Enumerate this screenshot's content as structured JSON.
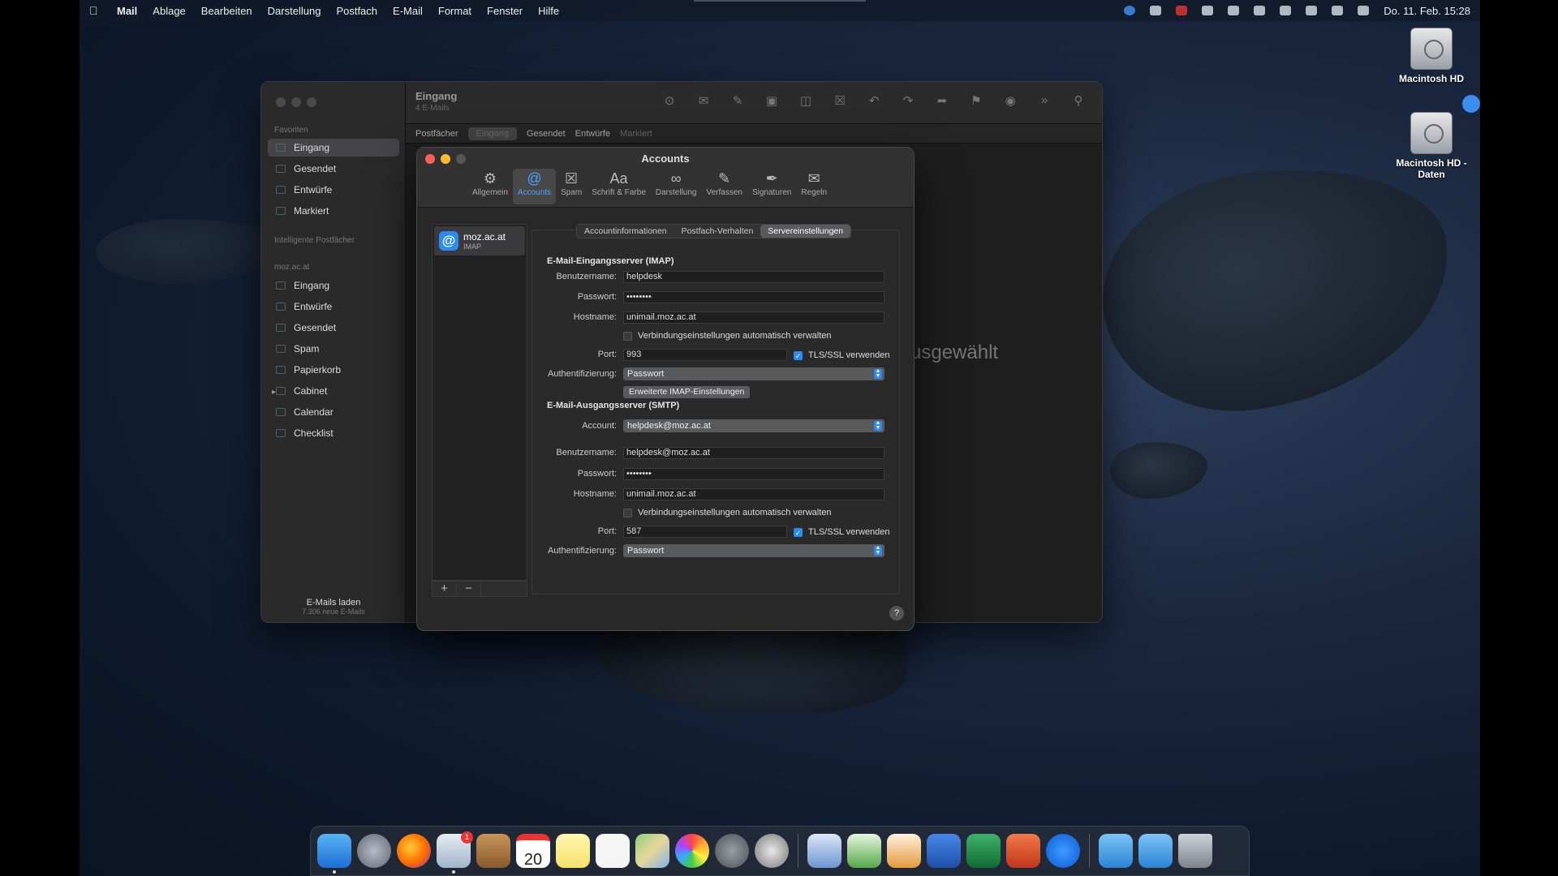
{
  "menubar": {
    "app": "Mail",
    "items": [
      "Ablage",
      "Bearbeiten",
      "Darstellung",
      "Postfach",
      "E-Mail",
      "Format",
      "Fenster",
      "Hilfe"
    ],
    "clock": "Do. 11. Feb. 15:28"
  },
  "desktop": {
    "disk1": "Macintosh HD",
    "disk2": "Macintosh HD - Daten"
  },
  "mail": {
    "toolbar_title": "Eingang",
    "toolbar_sub": "4 E-Mails",
    "favbar": {
      "postfaecher": "Postfächer",
      "eingang": "Eingang",
      "gesendet": "Gesendet",
      "entwuerfe": "Entwürfe",
      "markiert": "Markiert"
    },
    "sidebar": {
      "favoriten": "Favoriten",
      "fav_items": [
        "Eingang",
        "Gesendet",
        "Entwürfe",
        "Markiert"
      ],
      "intelligente": "Intelligente Postfächer",
      "account": "moz.ac.at",
      "acc_items": [
        "Eingang",
        "Entwürfe",
        "Gesendet",
        "Spam",
        "Papierkorb",
        "Cabinet",
        "Calendar",
        "Checklist"
      ],
      "footer_a": "E-Mails laden",
      "footer_b": "7.306 neue E-Mails"
    },
    "empty": "usgewählt"
  },
  "prefs": {
    "title": "Accounts",
    "tabs": [
      "Allgemein",
      "Accounts",
      "Spam",
      "Schrift & Farbe",
      "Darstellung",
      "Verfassen",
      "Signaturen",
      "Regeln"
    ],
    "account_name": "moz.ac.at",
    "account_type": "IMAP",
    "subtabs": [
      "Accountinformationen",
      "Postfach-Verhalten",
      "Servereinstellungen"
    ],
    "imap": {
      "heading": "E-Mail-Eingangsserver (IMAP)",
      "user_label": "Benutzername:",
      "user": "helpdesk",
      "pass_label": "Passwort:",
      "pass": "••••••••",
      "host_label": "Hostname:",
      "host": "unimail.moz.ac.at",
      "auto": "Verbindungseinstellungen automatisch verwalten",
      "port_label": "Port:",
      "port": "993",
      "tls": "TLS/SSL verwenden",
      "auth_label": "Authentifizierung:",
      "auth": "Passwort",
      "advanced": "Erweiterte IMAP-Einstellungen"
    },
    "smtp": {
      "heading": "E-Mail-Ausgangsserver (SMTP)",
      "account_label": "Account:",
      "account": "helpdesk@moz.ac.at",
      "user_label": "Benutzername:",
      "user": "helpdesk@moz.ac.at",
      "pass_label": "Passwort:",
      "pass": "••••••••",
      "host_label": "Hostname:",
      "host": "unimail.moz.ac.at",
      "auto": "Verbindungseinstellungen automatisch verwalten",
      "port_label": "Port:",
      "port": "587",
      "tls": "TLS/SSL verwenden",
      "auth_label": "Authentifizierung:",
      "auth": "Passwort"
    },
    "help": "?"
  },
  "dock": {
    "calendar_day": "20",
    "mail_badge": "1"
  }
}
